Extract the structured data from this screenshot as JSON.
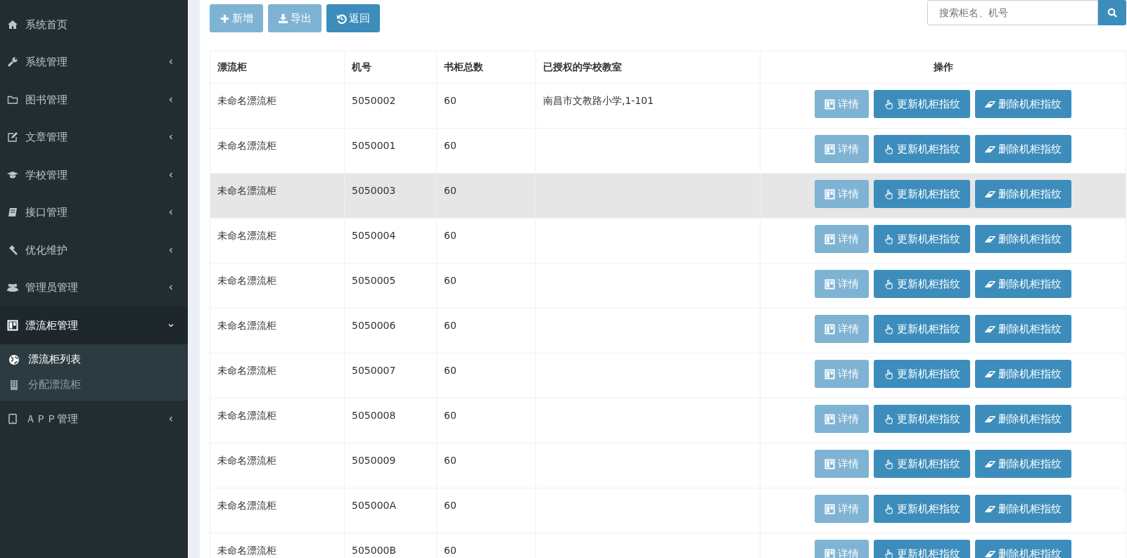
{
  "sidebar": {
    "items": [
      {
        "label": "系统首页"
      },
      {
        "label": "系统管理",
        "expanded": false
      },
      {
        "label": "图书管理",
        "expanded": false
      },
      {
        "label": "文章管理",
        "expanded": false
      },
      {
        "label": "学校管理",
        "expanded": false
      },
      {
        "label": "接口管理",
        "expanded": false
      },
      {
        "label": "优化维护",
        "expanded": false
      },
      {
        "label": "管理员管理",
        "expanded": false
      },
      {
        "label": "漂流柜管理",
        "expanded": true,
        "children": [
          {
            "label": "漂流柜列表",
            "selected": true
          },
          {
            "label": "分配漂流柜",
            "selected": false
          }
        ]
      },
      {
        "label": "ＡＰＰ管理",
        "expanded": false
      }
    ]
  },
  "toolbar": {
    "buttons": [
      {
        "label": "新增",
        "disabled": true
      },
      {
        "label": "导出",
        "disabled": true
      },
      {
        "label": "返回",
        "disabled": false
      }
    ],
    "search": {
      "placeholder": "搜索柜名、机号"
    }
  },
  "table": {
    "columns": [
      "漂流柜",
      "机号",
      "书柜总数",
      "已授权的学校教室",
      "操作"
    ],
    "rows": [
      {
        "name": "未命名漂流柜",
        "id": "5050002",
        "total": "60",
        "classroom": "南昌市文教路小学,1-101",
        "hovered": false,
        "actions": [
          {
            "label": "详情",
            "disabled": true
          },
          {
            "label": "更新机柜指纹",
            "disabled": false
          },
          {
            "label": "删除机柜指纹",
            "disabled": false
          }
        ]
      },
      {
        "name": "未命名漂流柜",
        "id": "5050001",
        "total": "60",
        "hovered": false,
        "actions": [
          {
            "label": "详情",
            "disabled": true
          },
          {
            "label": "更新机柜指纹",
            "disabled": false
          },
          {
            "label": "删除机柜指纹",
            "disabled": false
          }
        ]
      },
      {
        "name": "未命名漂流柜",
        "id": "5050003",
        "total": "60",
        "hovered": true,
        "actions": [
          {
            "label": "详情",
            "disabled": true
          },
          {
            "label": "更新机柜指纹",
            "disabled": false
          },
          {
            "label": "删除机柜指纹",
            "disabled": false
          }
        ]
      },
      {
        "name": "未命名漂流柜",
        "id": "5050004",
        "total": "60",
        "hovered": false,
        "actions": [
          {
            "label": "详情",
            "disabled": true
          },
          {
            "label": "更新机柜指纹",
            "disabled": false
          },
          {
            "label": "删除机柜指纹",
            "disabled": false
          }
        ]
      },
      {
        "name": "未命名漂流柜",
        "id": "5050005",
        "total": "60",
        "hovered": false,
        "actions": [
          {
            "label": "详情",
            "disabled": true
          },
          {
            "label": "更新机柜指纹",
            "disabled": false
          },
          {
            "label": "删除机柜指纹",
            "disabled": false
          }
        ]
      },
      {
        "name": "未命名漂流柜",
        "id": "5050006",
        "total": "60",
        "hovered": false,
        "actions": [
          {
            "label": "详情",
            "disabled": true
          },
          {
            "label": "更新机柜指纹",
            "disabled": false
          },
          {
            "label": "删除机柜指纹",
            "disabled": false
          }
        ]
      },
      {
        "name": "未命名漂流柜",
        "id": "5050007",
        "total": "60",
        "hovered": false,
        "actions": [
          {
            "label": "详情",
            "disabled": true
          },
          {
            "label": "更新机柜指纹",
            "disabled": false
          },
          {
            "label": "删除机柜指纹",
            "disabled": false
          }
        ]
      },
      {
        "name": "未命名漂流柜",
        "id": "5050008",
        "total": "60",
        "hovered": false,
        "actions": [
          {
            "label": "详情",
            "disabled": true
          },
          {
            "label": "更新机柜指纹",
            "disabled": false
          },
          {
            "label": "删除机柜指纹",
            "disabled": false
          }
        ]
      },
      {
        "name": "未命名漂流柜",
        "id": "5050009",
        "total": "60",
        "hovered": false,
        "actions": [
          {
            "label": "详情",
            "disabled": true
          },
          {
            "label": "更新机柜指纹",
            "disabled": false
          },
          {
            "label": "删除机柜指纹",
            "disabled": false
          }
        ]
      },
      {
        "name": "未命名漂流柜",
        "id": "505000A",
        "total": "60",
        "hovered": false,
        "actions": [
          {
            "label": "详情",
            "disabled": true
          },
          {
            "label": "更新机柜指纹",
            "disabled": false
          },
          {
            "label": "删除机柜指纹",
            "disabled": false
          }
        ]
      },
      {
        "name": "未命名漂流柜",
        "id": "505000B",
        "total": "60",
        "hovered": false,
        "actions": [
          {
            "label": "详情",
            "disabled": true
          },
          {
            "label": "更新机柜指纹",
            "disabled": false
          },
          {
            "label": "删除机柜指纹",
            "disabled": false
          }
        ]
      }
    ]
  }
}
